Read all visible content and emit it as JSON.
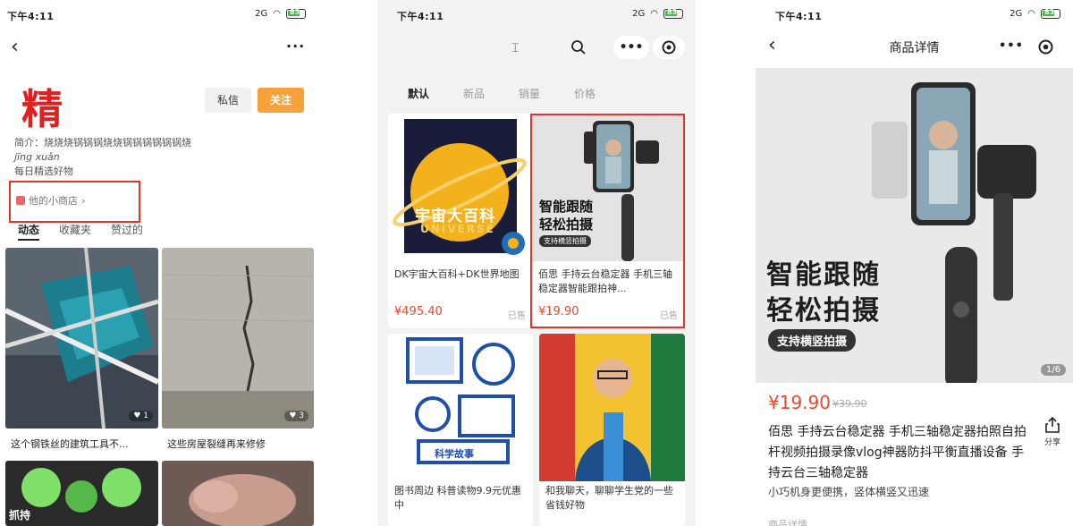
{
  "status_bar": {
    "time": "下午4:11",
    "signal": "2G",
    "battery": "83"
  },
  "panel1": {
    "logo_char": "精",
    "message_button": "私信",
    "follow_button": "关注",
    "intro_label": "简介：",
    "intro_text": "烧烧烧锅锅锅烧烧锅锅锅锅锅锅烧",
    "pinyin": "jīng xuǎn",
    "intro_line3": "每日精选好物",
    "shop_link": "他的小商店",
    "tabs": [
      "动态",
      "收藏夹",
      "赞过的"
    ],
    "tiles": [
      {
        "caption": "这个钢铁丝的建筑工具不...",
        "likes": "1"
      },
      {
        "caption": "这些房屋裂缝再来修修",
        "likes": "3"
      },
      {
        "caption": "抓持",
        "likes": ""
      },
      {
        "caption": "",
        "likes": ""
      }
    ]
  },
  "panel2": {
    "tabs": [
      "默认",
      "新品",
      "销量",
      "价格"
    ],
    "products": [
      {
        "title": "DK宇宙大百科+DK世界地图",
        "price": "¥495.40",
        "sold": "已售",
        "cover_main": "宇宙大百科",
        "cover_sub": "UNIVERSE"
      },
      {
        "title": "佰思 手持云台稳定器 手机三轴稳定器智能跟拍神...",
        "price": "¥19.90",
        "sold": "已售",
        "cover_main1": "智能跟随",
        "cover_main2": "轻松拍摄",
        "cover_badge": "支持横竖拍摄"
      },
      {
        "title": "图书周边 科普读物9.9元优惠中",
        "price": "",
        "sold": "",
        "cover_label": "科学故事"
      },
      {
        "title": "和我聊天，聊聊学生党的一些省钱好物",
        "price": "",
        "sold": ""
      }
    ]
  },
  "panel3": {
    "page_title": "商品详情",
    "hero_line1": "智能跟随",
    "hero_line2": "轻松拍摄",
    "hero_badge": "支持横竖拍摄",
    "hero_counter": "1/6",
    "price": "¥19.90",
    "original_price": "¥39.90",
    "description": "佰思 手持云台稳定器 手机三轴稳定器拍照自拍杆视频拍摄录像vlog神器防抖平衡直播设备 手持云台三轴稳定器",
    "subtitle": "小巧机身更便携，竖体横竖又迅速",
    "more_label": "商品详情",
    "share_label": "分享"
  }
}
